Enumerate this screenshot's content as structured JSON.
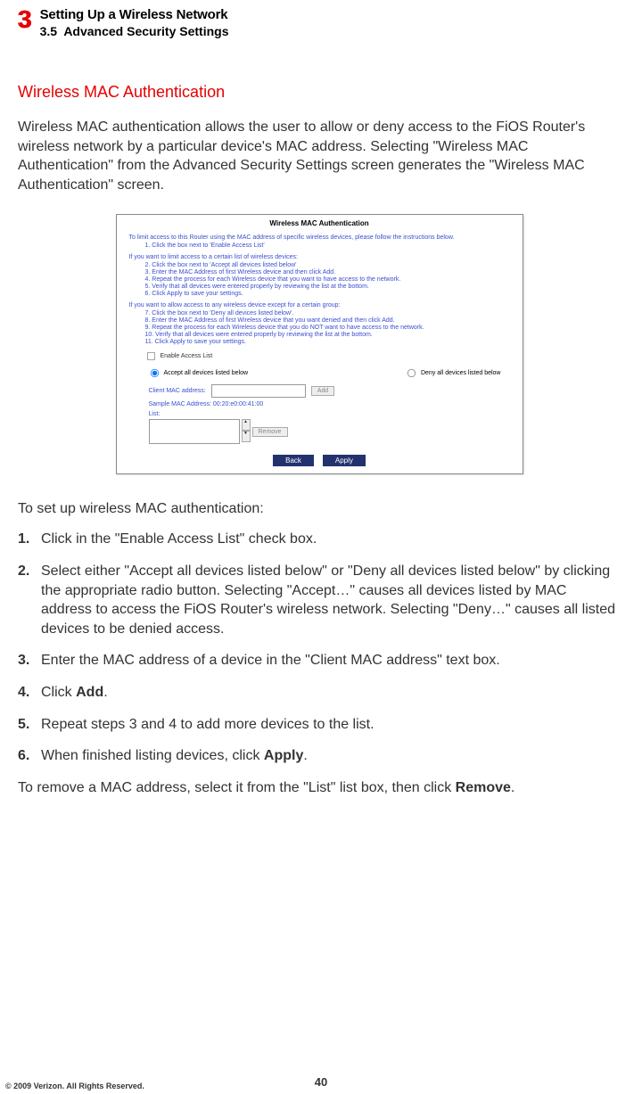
{
  "header": {
    "chapter_number": "3",
    "chapter_title": "Setting Up a Wireless Network",
    "section_number": "3.5",
    "section_name": "Advanced Security Settings"
  },
  "content": {
    "topic": "Wireless MAC Authentication",
    "intro": "Wireless MAC authentication allows the user to allow or deny access to the FiOS Router's wireless network by a particular device's MAC address. Selecting \"Wireless MAC Authentication\" from the Advanced Security Settings screen generates the \"Wireless MAC Authentication\" screen.",
    "instructions_lead": "To set up wireless MAC authentication:",
    "steps": [
      {
        "num": "1.",
        "text": "Click in the \"Enable Access List\" check box."
      },
      {
        "num": "2.",
        "text": "Select either \"Accept all devices listed below\" or \"Deny all devices listed below\" by clicking the appropriate radio button. Selecting \"Accept…\" causes all devices listed by MAC address to access the FiOS Router's wireless network. Selecting \"Deny…\" causes all listed devices to be denied access."
      },
      {
        "num": "3.",
        "text": "Enter the MAC address of a device in the \"Client MAC address\" text box."
      },
      {
        "num": "4.",
        "text_pre": "Click ",
        "bold": "Add",
        "text_post": "."
      },
      {
        "num": "5.",
        "text": "Repeat steps 3 and 4 to add more devices to the list."
      },
      {
        "num": "6.",
        "text_pre": "When finished listing devices, click ",
        "bold": "Apply",
        "text_post": "."
      }
    ],
    "remove_pre": "To remove a MAC address, select it from the \"List\" list box, then click ",
    "remove_bold": "Remove",
    "remove_post": "."
  },
  "figure": {
    "title": "Wireless MAC Authentication",
    "lead": "To limit access to this Router using the MAC address of specific wireless devices, please follow the instructions below.",
    "group1": [
      "1. Click the box next to 'Enable Access List'"
    ],
    "group2_head": "If you want to limit access to a certain list of wireless devices:",
    "group2": [
      "2. Click the box next to 'Accept all devices listed below'",
      "3. Enter the MAC Address of first Wireless device and then click Add.",
      "4. Repeat the process for each Wireless device that you want to have access to the network.",
      "5. Verify that all devices were entered properly by reviewing the list at the bottom.",
      "6. Click Apply to save your settings."
    ],
    "group3_head": "If you want to allow access to any wireless device except for a certain group:",
    "group3": [
      "7. Click the box next to 'Deny all devices listed below'.",
      "8. Enter the MAC Address of first Wireless device that you want denied and then click Add.",
      "9. Repeat the process for each Wireless device that you do NOT want to have access to the network.",
      "10. Verify that all devices were entered properly by reviewing the list at the bottom.",
      "11. Click Apply to save your settings."
    ],
    "enable_label": "Enable Access List",
    "accept_label": "Accept all devices listed below",
    "deny_label": "Deny all devices listed below",
    "client_mac_label": "Client MAC address:",
    "add_btn": "Add",
    "sample": "Sample MAC Address: 00:20:e0:00:41:00",
    "list_label": "List:",
    "remove_btn": "Remove",
    "back_btn": "Back",
    "apply_btn": "Apply"
  },
  "footer": {
    "page_number": "40",
    "copyright": "© 2009 Verizon. All Rights Reserved."
  }
}
